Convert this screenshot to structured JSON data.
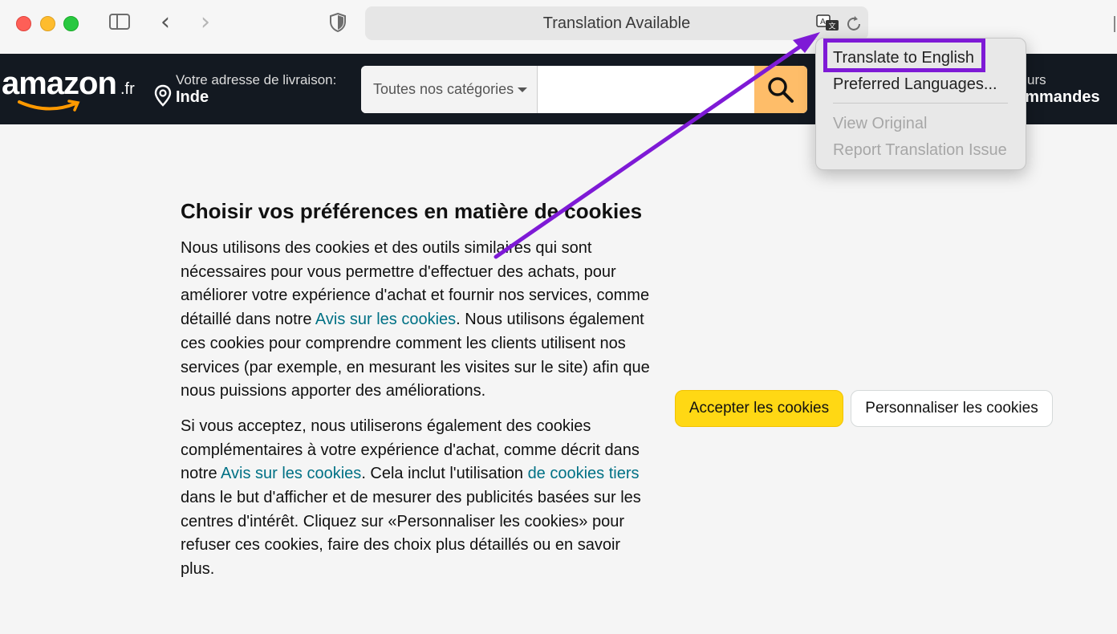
{
  "browser": {
    "url_bar_text": "Translation Available"
  },
  "header": {
    "logo_text": "amazon",
    "logo_suffix": ".fr",
    "delivery_label": "Votre adresse de livraison:",
    "delivery_location": "Inde",
    "search_category": "Toutes nos catégories",
    "search_placeholder": "",
    "orders_top": "urs",
    "orders_bottom": "ommandes"
  },
  "translate_menu": {
    "items": [
      {
        "label": "Translate to English",
        "enabled": true,
        "highlighted": true
      },
      {
        "label": "Preferred Languages...",
        "enabled": true
      },
      {
        "label": "View Original",
        "enabled": false
      },
      {
        "label": "Report Translation Issue",
        "enabled": false
      }
    ]
  },
  "cookie_notice": {
    "title": "Choisir vos préférences en matière de cookies",
    "p1_a": "Nous utilisons des cookies et des outils similaires qui sont nécessaires pour vous permettre d'effectuer des achats, pour améliorer votre expérience d'achat et fournir nos services, comme détaillé dans notre ",
    "p1_link": "Avis sur les cookies",
    "p1_b": ". Nous utilisons également ces cookies pour comprendre comment les clients utilisent nos services (par exemple, en mesurant les visites sur le site) afin que nous puissions apporter des améliorations.",
    "p2_a": "Si vous acceptez, nous utiliserons également des cookies complémentaires à votre expérience d'achat, comme décrit dans notre ",
    "p2_link1": "Avis sur les cookies",
    "p2_b": ". Cela inclut l'utilisation ",
    "p2_link2": "de cookies tiers",
    "p2_c": " dans le but d'afficher et de mesurer des publicités basées sur les centres d'intérêt. Cliquez sur «Personnaliser les cookies» pour refuser ces cookies, faire des choix plus détaillés ou en savoir plus.",
    "accept_label": "Accepter les cookies",
    "customize_label": "Personnaliser les cookies"
  },
  "colors": {
    "amazon_header": "#131921",
    "accept_button": "#ffd814",
    "search_button": "#febd69",
    "link": "#007185",
    "annotation": "#7e1ad6"
  },
  "icons": [
    "sidebar-icon",
    "back-icon",
    "forward-icon",
    "shield-icon",
    "translate-icon",
    "reload-icon",
    "location-icon",
    "search-icon"
  ]
}
